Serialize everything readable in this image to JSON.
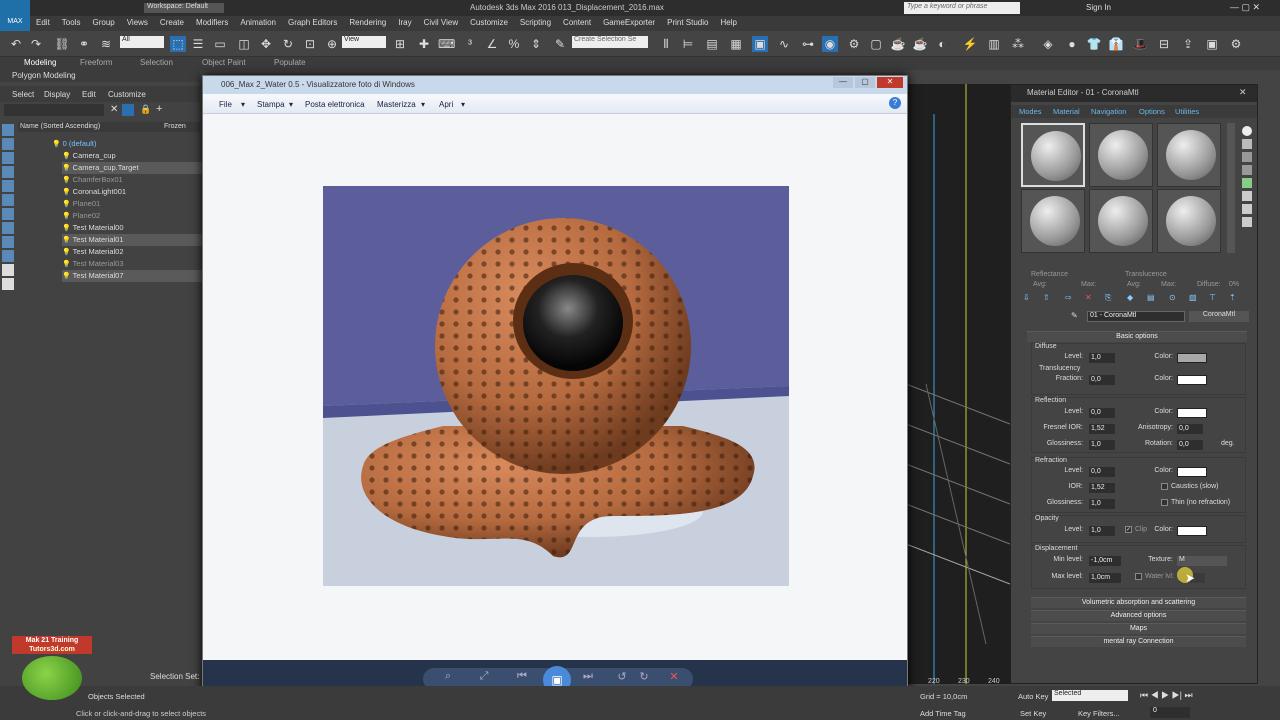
{
  "app": {
    "logo_text": "MAX",
    "title": "Autodesk 3ds Max 2016    013_Displacement_2016.max",
    "workspace": "Workspace: Default",
    "search_placeholder": "Type a keyword or phrase",
    "signin": "Sign In"
  },
  "menu": [
    "Edit",
    "Tools",
    "Group",
    "Views",
    "Create",
    "Modifiers",
    "Animation",
    "Graph Editors",
    "Rendering",
    "Iray",
    "Civil View",
    "Customize",
    "Scripting",
    "Content",
    "GameExporter",
    "Print Studio",
    "Help"
  ],
  "toolbar": {
    "filter": "All",
    "view": "View",
    "selection_set": "Create Selection Se"
  },
  "ribbon": {
    "tabs": [
      "Modeling",
      "Freeform",
      "Selection",
      "Object Paint",
      "Populate"
    ],
    "sub": "Polygon Modeling"
  },
  "scene_explorer": {
    "menu": [
      "Select",
      "Display",
      "Edit",
      "Customize"
    ],
    "col_name": "Name (Sorted Ascending)",
    "col_frozen": "Frozen",
    "rows": [
      {
        "name": "0 (default)",
        "cls": "root"
      },
      {
        "name": "Camera_cup",
        "cls": ""
      },
      {
        "name": "Camera_cup.Target",
        "cls": "sel"
      },
      {
        "name": "ChamferBox01",
        "cls": "dim"
      },
      {
        "name": "CoronaLight001",
        "cls": ""
      },
      {
        "name": "Plane01",
        "cls": "dim"
      },
      {
        "name": "Plane02",
        "cls": "dim"
      },
      {
        "name": "Test Material00",
        "cls": ""
      },
      {
        "name": "Test Material01",
        "cls": "sel"
      },
      {
        "name": "Test Material02",
        "cls": ""
      },
      {
        "name": "Test Material03",
        "cls": "dim"
      },
      {
        "name": "Test Material07",
        "cls": "sel"
      }
    ]
  },
  "photo_viewer": {
    "title": "006_Max 2_Water 0.5 - Visualizzatore foto di Windows",
    "menu": [
      "File",
      "Stampa",
      "Posta elettronica",
      "Masterizza",
      "Apri"
    ]
  },
  "material_editor": {
    "title": "Material Editor - 01 - CoronaMtl",
    "menu": [
      "Modes",
      "Material",
      "Navigation",
      "Options",
      "Utilities"
    ],
    "reflectance": "Reflectance",
    "translucence": "Translucence",
    "avg": "Avg:",
    "max": "Max:",
    "diffuse_lbl": "Diffuse:",
    "diffuse_val": "0%",
    "mat_name": "01 - CoronaMtl",
    "mat_type": "CoronaMtl",
    "basic_options": "Basic options",
    "diffuse": {
      "label": "Diffuse",
      "level_lbl": "Level:",
      "level": "1,0",
      "color_lbl": "Color:",
      "translucency": "Translucency",
      "fraction_lbl": "Fraction:",
      "fraction": "0,0"
    },
    "reflection": {
      "label": "Reflection",
      "level": "0,0",
      "fresnel_lbl": "Fresnel IOR:",
      "fresnel": "1,52",
      "aniso_lbl": "Anisotropy:",
      "aniso": "0,0",
      "gloss_lbl": "Glossiness:",
      "gloss": "1,0",
      "rot_lbl": "Rotation:",
      "rot": "0,0",
      "deg": "deg."
    },
    "refraction": {
      "label": "Refraction",
      "level": "0,0",
      "ior_lbl": "IOR:",
      "ior": "1,52",
      "gloss": "1,0",
      "caustics": "Caustics (slow)",
      "thin": "Thin (no refraction)"
    },
    "opacity": {
      "label": "Opacity",
      "level": "1,0",
      "clip": "Clip"
    },
    "displacement": {
      "label": "Displacement",
      "min_lbl": "Min level:",
      "min": "-1,0cm",
      "max_lbl": "Max level:",
      "max": "1,0cm",
      "texture_lbl": "Texture:",
      "texture": "M",
      "water_lbl": "Water lvl:"
    },
    "rollouts": [
      "Volumetric absorption and scattering",
      "Advanced options",
      "Maps",
      "mental ray Connection"
    ]
  },
  "status": {
    "selection_set": "Selection Set:",
    "objects_selected": "Objects Selected",
    "hint": "Click or click-and-drag to select objects",
    "grid": "Grid = 10,0cm",
    "add_time_tag": "Add Time Tag",
    "auto_key": "Auto Key",
    "set_key": "Set Key",
    "selected": "Selected",
    "key_filters": "Key Filters...",
    "frame": "0",
    "ticks": [
      "220",
      "230",
      "240"
    ]
  },
  "logo": {
    "line1": "Mak 21 Training",
    "line2": "Tutors3d.com"
  }
}
